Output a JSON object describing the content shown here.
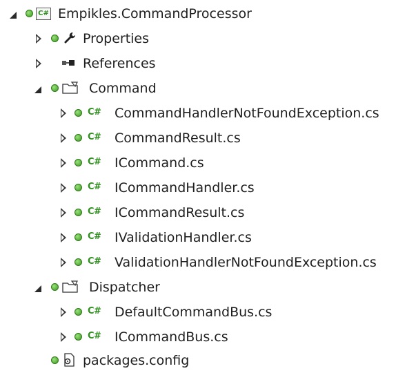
{
  "tree": {
    "project": {
      "label": "Empikles.CommandProcessor",
      "icon": "csharp-project-icon"
    },
    "properties": {
      "label": "Properties",
      "icon": "wrench-icon"
    },
    "references": {
      "label": "References",
      "icon": "references-icon"
    },
    "command_folder": {
      "label": "Command",
      "icon": "folder-icon",
      "files": [
        {
          "label": "CommandHandlerNotFoundException.cs"
        },
        {
          "label": "CommandResult.cs"
        },
        {
          "label": "ICommand.cs"
        },
        {
          "label": "ICommandHandler.cs"
        },
        {
          "label": "ICommandResult.cs"
        },
        {
          "label": "IValidationHandler.cs"
        },
        {
          "label": "ValidationHandlerNotFoundException.cs"
        }
      ]
    },
    "dispatcher_folder": {
      "label": "Dispatcher",
      "icon": "folder-icon",
      "files": [
        {
          "label": "DefaultCommandBus.cs"
        },
        {
          "label": "ICommandBus.cs"
        }
      ]
    },
    "packages": {
      "label": "packages.config",
      "icon": "config-file-icon"
    }
  },
  "csharp_badge": "C#",
  "colors": {
    "status_green": "#3a9a1e",
    "csharp_green": "#2f8f1f",
    "text": "#1e1e1e"
  }
}
